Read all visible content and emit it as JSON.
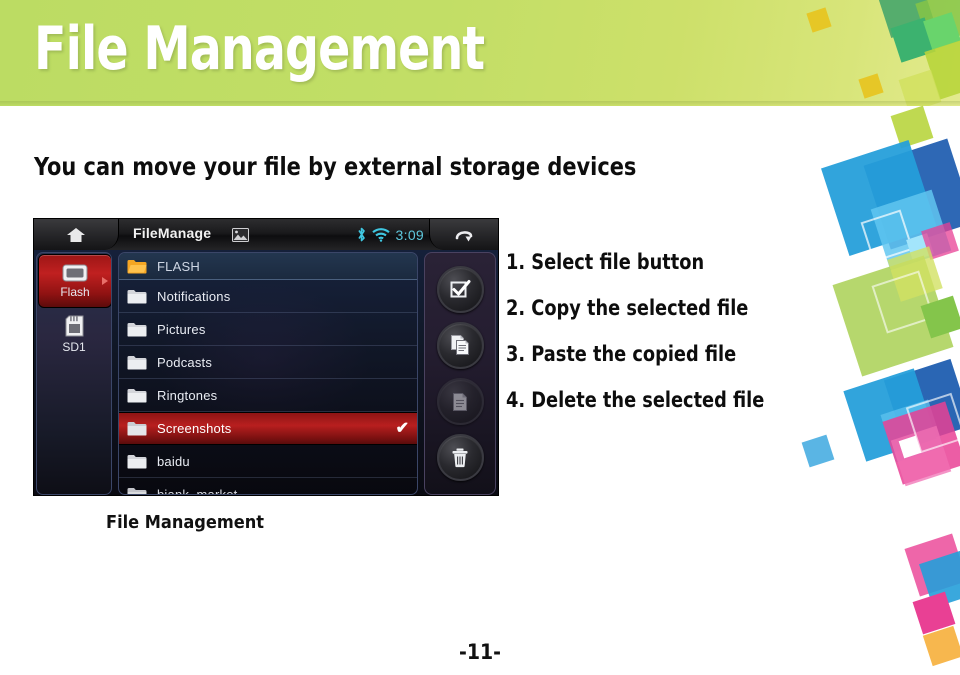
{
  "header": {
    "title": "File Management",
    "bg_color": "#c2de66",
    "title_color": "#ffffff"
  },
  "subtitle": "You can move your file by external storage devices",
  "device": {
    "statusbar": {
      "home_icon": "home-icon",
      "app_title": "FileManage",
      "image_icon": "image-icon",
      "bluetooth_icon": "bluetooth-icon",
      "wifi_icon": "wifi-icon",
      "time": "3:09",
      "back_icon": "return-arrow-icon",
      "accent_color": "#5ec8dd"
    },
    "drives": [
      {
        "label": "Flash",
        "icon": "internal-storage-icon",
        "selected": true
      },
      {
        "label": "SD1",
        "icon": "sd-card-icon",
        "selected": false
      }
    ],
    "file_list": {
      "header": {
        "label": "FLASH",
        "icon": "folder-open-icon",
        "icon_color": "#f5a623"
      },
      "items": [
        {
          "label": "Notifications",
          "icon": "folder-icon",
          "selected": false,
          "partial": false
        },
        {
          "label": "Pictures",
          "icon": "folder-icon",
          "selected": false,
          "partial": false
        },
        {
          "label": "Podcasts",
          "icon": "folder-icon",
          "selected": false,
          "partial": false
        },
        {
          "label": "Ringtones",
          "icon": "folder-icon",
          "selected": false,
          "partial": false
        },
        {
          "label": "Screenshots",
          "icon": "folder-icon",
          "selected": true,
          "partial": false
        },
        {
          "label": "baidu",
          "icon": "folder-icon",
          "selected": false,
          "partial": false
        },
        {
          "label": "biank_market",
          "icon": "folder-icon",
          "selected": false,
          "partial": true
        }
      ],
      "selected_check": "✔",
      "selected_color": "#b81f1f"
    },
    "actions": [
      {
        "name": "select-file-button",
        "icon": "checkbox-checked-icon",
        "enabled": true
      },
      {
        "name": "copy-button",
        "icon": "copy-documents-icon",
        "enabled": true
      },
      {
        "name": "paste-button",
        "icon": "paste-document-icon",
        "enabled": false
      },
      {
        "name": "delete-button",
        "icon": "trash-icon",
        "enabled": true
      }
    ]
  },
  "caption": "File Management",
  "steps": [
    "1. Select file button",
    "2. Copy the selected file",
    "3. Paste the copied file",
    "4. Delete the selected file"
  ],
  "page_number": "-11-",
  "decoration": {
    "palette": [
      "#7ec242",
      "#b5d334",
      "#4aa96c",
      "#e8c520",
      "#1a9ad8",
      "#0b4fa8",
      "#59c3f0",
      "#9cc93a",
      "#e8368f",
      "#f06ab0",
      "#f5a623"
    ]
  }
}
